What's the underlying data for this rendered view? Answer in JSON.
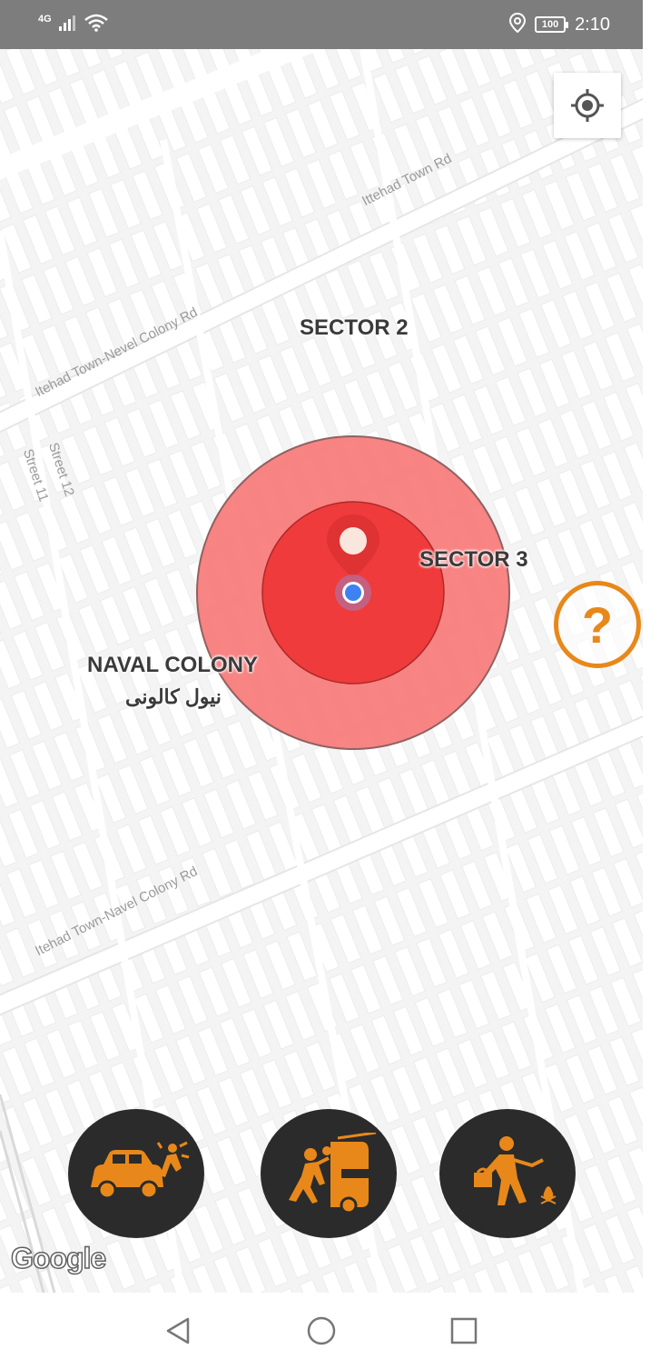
{
  "status_bar": {
    "network_type": "4G",
    "battery_level": "100",
    "time": "2:10",
    "icons": [
      "signal-icon",
      "wifi-icon",
      "location-icon",
      "battery-icon"
    ]
  },
  "map": {
    "road_labels": {
      "ittehad_town_rd": "Ittehad Town Rd",
      "navel_colony_rd_top": "Itehad Town-Nevel Colony Rd",
      "navel_colony_rd_bottom": "Itehad Town-Navel Colony Rd",
      "street_12": "Street 12",
      "street_11": "Street 11"
    },
    "area_labels": {
      "sector_2": "SECTOR 2",
      "sector_3": "SECTOR 3",
      "naval_colony": "NAVAL COLONY",
      "naval_colony_urdu": "نیول کالونی"
    },
    "help_label": "?",
    "attribution": "Google",
    "colors": {
      "outer_zone": "#f87e7e",
      "inner_zone": "#ef3b3b",
      "user_dot": "#3d82f0",
      "accent": "#e8881a",
      "action_bg": "#2b2b2b"
    }
  },
  "actions": [
    {
      "name": "car-accident-button",
      "icon": "car-accident-icon"
    },
    {
      "name": "car-robbery-button",
      "icon": "car-robbery-icon"
    },
    {
      "name": "snatching-button",
      "icon": "snatching-icon"
    }
  ],
  "nav": {
    "icons": [
      "back-icon",
      "home-icon",
      "recents-icon"
    ]
  }
}
